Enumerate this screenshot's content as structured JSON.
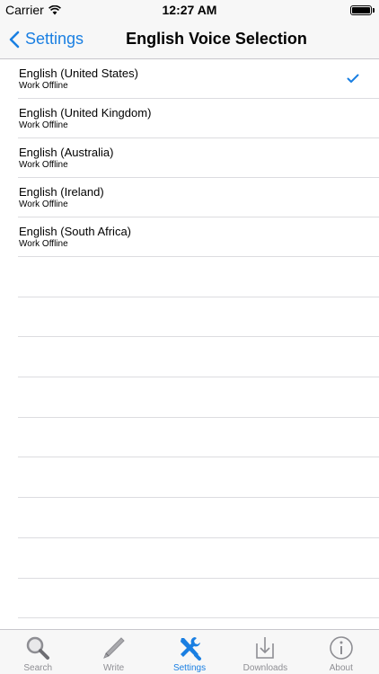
{
  "status_bar": {
    "carrier": "Carrier",
    "time": "12:27 AM"
  },
  "nav": {
    "back_label": "Settings",
    "title": "English Voice Selection"
  },
  "voices": [
    {
      "title": "English (United States)",
      "subtitle": "Work Offline",
      "selected": true
    },
    {
      "title": "English (United Kingdom)",
      "subtitle": "Work Offline",
      "selected": false
    },
    {
      "title": "English (Australia)",
      "subtitle": "Work Offline",
      "selected": false
    },
    {
      "title": "English (Ireland)",
      "subtitle": "Work Offline",
      "selected": false
    },
    {
      "title": "English (South Africa)",
      "subtitle": "Work Offline",
      "selected": false
    }
  ],
  "tabs": [
    {
      "label": "Search",
      "icon": "search-icon",
      "active": false
    },
    {
      "label": "Write",
      "icon": "pencil-icon",
      "active": false
    },
    {
      "label": "Settings",
      "icon": "tools-icon",
      "active": true
    },
    {
      "label": "Downloads",
      "icon": "download-icon",
      "active": false
    },
    {
      "label": "About",
      "icon": "info-icon",
      "active": false
    }
  ],
  "colors": {
    "accent": "#1a7fe2",
    "inactive": "#8e8e93",
    "bar_background": "#f7f7f7"
  }
}
